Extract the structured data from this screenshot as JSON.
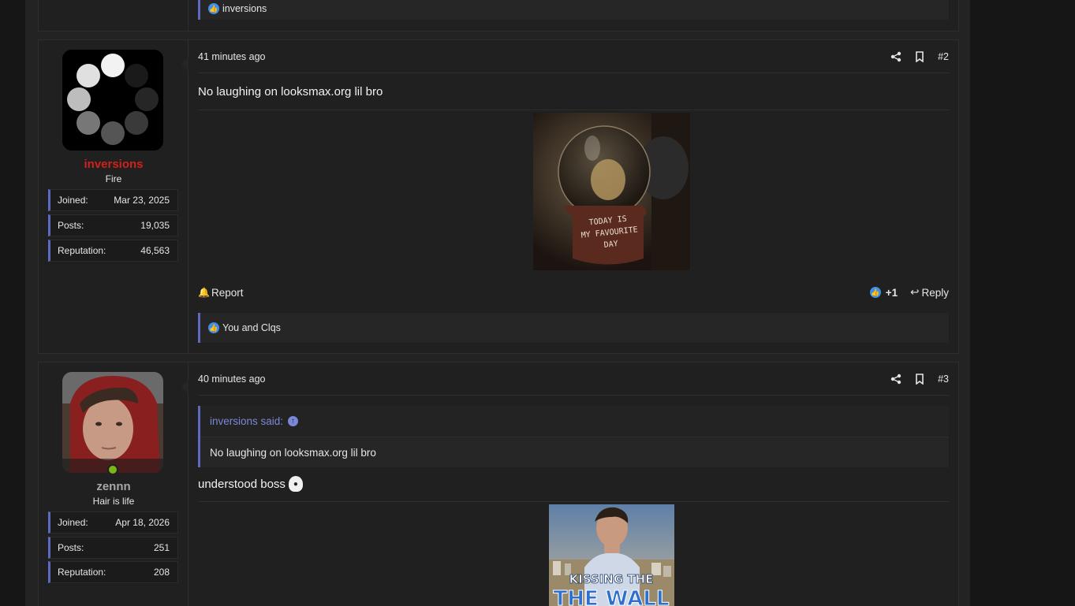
{
  "post1": {
    "reactions_text": "inversions"
  },
  "post2": {
    "username": "inversions",
    "user_title": "Fire",
    "stats": [
      {
        "label": "Joined:",
        "value": "Mar 23, 2025"
      },
      {
        "label": "Posts:",
        "value": "19,035"
      },
      {
        "label": "Reputation:",
        "value": "46,563"
      }
    ],
    "timestamp": "41 minutes ago",
    "post_number": "#2",
    "text": "No laughing on looksmax.org lil bro",
    "image_caption": "TODAY IS MY FAVOURITE DAY",
    "report_label": "Report",
    "like_count": "+1",
    "reply_label": "Reply",
    "reactions_text": "You and Clqs",
    "username_color": "#d0211c"
  },
  "post3": {
    "username": "zennn",
    "user_title": "Hair is life",
    "stats": [
      {
        "label": "Joined:",
        "value": "Apr 18, 2026"
      },
      {
        "label": "Posts:",
        "value": "251"
      },
      {
        "label": "Reputation:",
        "value": "208"
      }
    ],
    "timestamp": "40 minutes ago",
    "post_number": "#3",
    "quote_author": "inversions said:",
    "quote_text": "No laughing on looksmax.org lil bro",
    "text": "understood boss",
    "image_caption": "KISSING THE THE WALL",
    "username_color": "#a7a7a7"
  },
  "colors": {
    "accent": "#5c6bc0",
    "like": "#3e8fe8",
    "online": "#7cb518"
  }
}
